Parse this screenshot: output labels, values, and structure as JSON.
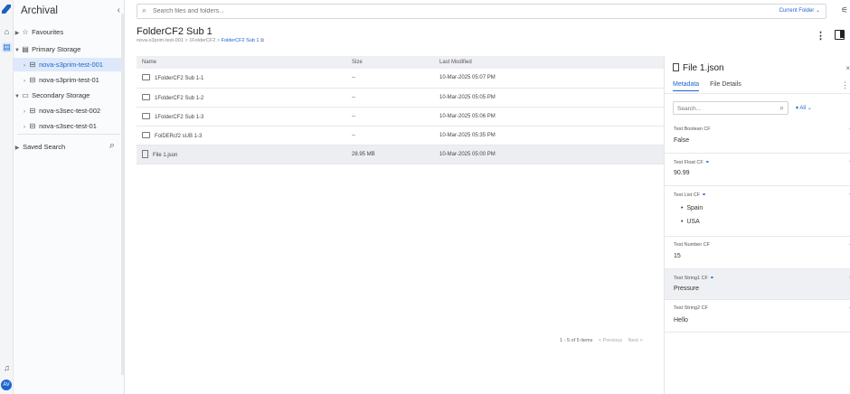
{
  "rail": {
    "avatar": "AV"
  },
  "nav": {
    "title": "Archival",
    "items": [
      {
        "label": "Favourites"
      },
      {
        "label": "Primary Storage"
      },
      {
        "label": "nova-s3prim-test-001"
      },
      {
        "label": "nova-s3prim-test-01"
      },
      {
        "label": "Secondary Storage"
      },
      {
        "label": "nova-s3sec-test-002"
      },
      {
        "label": "nova-s3sec-test-01"
      },
      {
        "label": "Saved Search"
      }
    ]
  },
  "search": {
    "placeholder": "Search files and folders...",
    "scope": "Current Folder"
  },
  "folder": {
    "title": "FolderCF2 Sub 1",
    "crumbs": [
      "nova-s3prim-test-001",
      "1FolderCF2",
      "FolderCF2 Sub 1"
    ]
  },
  "table": {
    "headers": [
      "Name",
      "Size",
      "Last Modified"
    ],
    "rows": [
      {
        "name": "1FolderCF2 Sub 1-1",
        "size": "--",
        "modified": "10-Mar-2025 05:07 PM"
      },
      {
        "name": "1FolderCF2 Sub 1-2",
        "size": "--",
        "modified": "10-Mar-2025 05:05 PM"
      },
      {
        "name": "1FolderCF2 Sub 1-3",
        "size": "--",
        "modified": "10-Mar-2025 05:06 PM"
      },
      {
        "name": "FolDERcf2 sUB 1-3",
        "size": "--",
        "modified": "10-Mar-2025 05:35 PM"
      },
      {
        "name": "File 1.json",
        "size": "28.95 MB",
        "modified": "10-Mar-2025 05:00 PM"
      }
    ]
  },
  "pager": {
    "summary": "1 - 5 of 5 items",
    "prev": "< Previous",
    "next": "Next >"
  },
  "details": {
    "title": "File 1.json",
    "tabs": [
      "Metadata",
      "File Details"
    ],
    "search_placeholder": "Search...",
    "filter_label": "All",
    "fields": [
      {
        "label": "Test Boolean CF",
        "value": "False"
      },
      {
        "label": "Test Float CF",
        "value": "90.99"
      },
      {
        "label": "Test List CF",
        "values": [
          "Spain",
          "USA"
        ]
      },
      {
        "label": "Test Number CF",
        "value": "15"
      },
      {
        "label": "Test String1 CF",
        "value": "Pressure"
      },
      {
        "label": "Test String2 CF",
        "value": "Hello"
      }
    ]
  }
}
